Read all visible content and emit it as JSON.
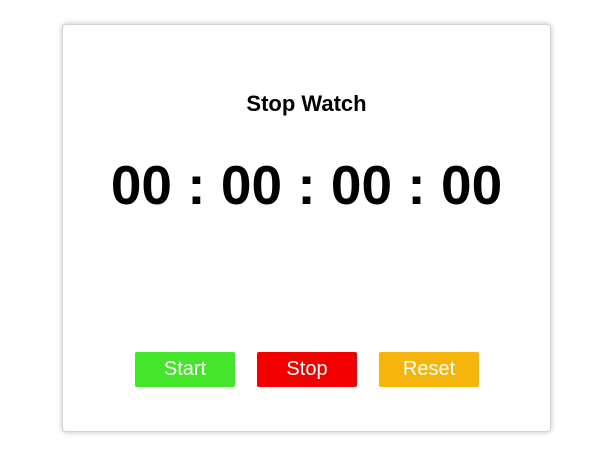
{
  "stopwatch": {
    "title": "Stop Watch",
    "time_display": "00 : 00 : 00 : 00",
    "buttons": {
      "start_label": "Start",
      "stop_label": "Stop",
      "reset_label": "Reset"
    }
  },
  "colors": {
    "start": "#44e52a",
    "stop": "#f10000",
    "reset": "#f5b50a",
    "text": "#000000"
  }
}
